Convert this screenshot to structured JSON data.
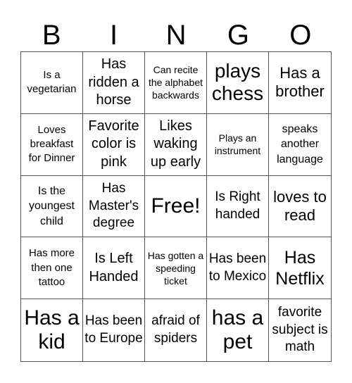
{
  "header": [
    "B",
    "I",
    "N",
    "G",
    "O"
  ],
  "cells": [
    "Is a vegetarian",
    "Has ridden a horse",
    "Can recite the alphabet backwards",
    "plays chess",
    "Has a brother",
    "Loves breakfast for Dinner",
    "Favorite color is pink",
    "Likes waking up early",
    "Plays an instrument",
    "speaks another language",
    "Is the youngest child",
    "Has Master's degree",
    "Free!",
    "Is Right handed",
    "loves to read",
    "Has more then one tattoo",
    "Is Left Handed",
    "Has gotten a speeding ticket",
    "Has been to Mexico",
    "Has Netflix",
    "Has a kid",
    "Has been to Europe",
    "afraid of spiders",
    "has a pet",
    "favorite subject is math"
  ]
}
